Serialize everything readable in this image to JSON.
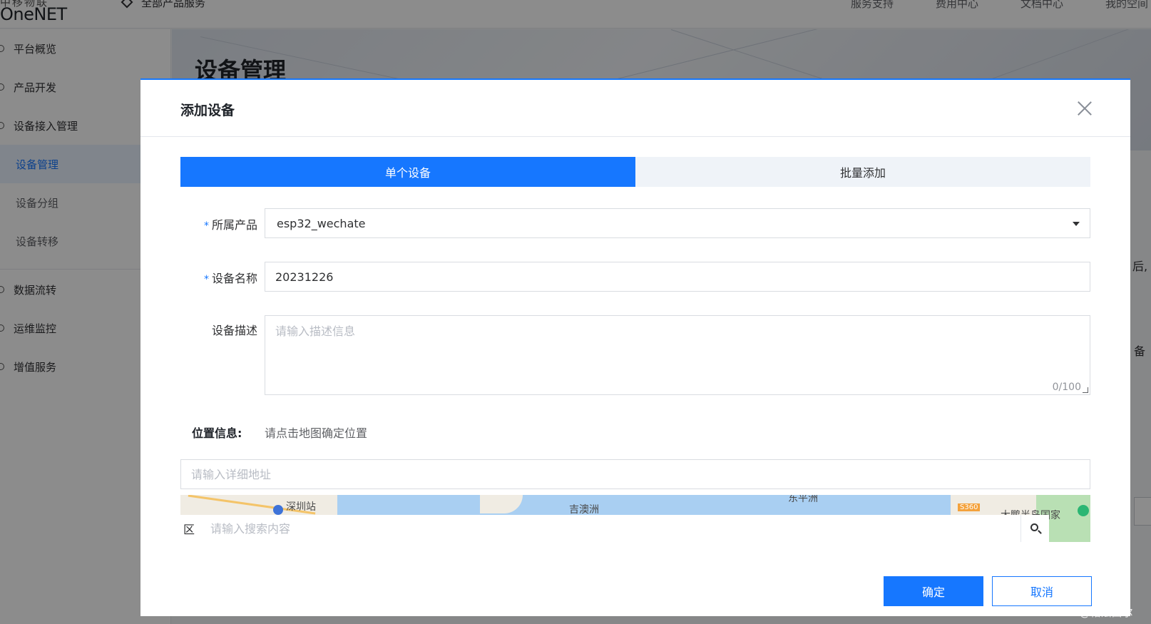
{
  "header": {
    "logo_top": "中移物联",
    "logo": "OneNET",
    "all_products": "全部产品服务",
    "nav": [
      "服务支持",
      "费用中心",
      "文档中心",
      "我的空间"
    ]
  },
  "sidebar": {
    "items": [
      "平台概览",
      "产品开发",
      "设备接入管理",
      "设备管理",
      "设备分组",
      "设备转移",
      "数据流转",
      "运维监控",
      "增值服务"
    ]
  },
  "page": {
    "title": "设备管理",
    "bg_fragments": [
      "后,",
      "备"
    ]
  },
  "modal": {
    "title": "添加设备",
    "tabs": [
      {
        "label": "单个设备",
        "active": true
      },
      {
        "label": "批量添加",
        "active": false
      }
    ],
    "product_label": "所属产品",
    "product_value": "esp32_wechate",
    "device_name_label": "设备名称",
    "device_name_value": "20231226",
    "description_label": "设备描述",
    "description_placeholder": "请输入描述信息",
    "description_counter": "0/100",
    "required_mark": "*",
    "location_label": "位置信息:",
    "location_hint": "请点击地图确定位置",
    "address_placeholder": "请输入详细地址",
    "map": {
      "labels": [
        "深圳站",
        "吉澳洲",
        "东平洲",
        "大鹏半岛国家"
      ],
      "road_marker": "S360",
      "search_prefix": "区",
      "search_placeholder": "请输入搜索内容"
    },
    "confirm_label": "确定",
    "cancel_label": "取消"
  },
  "watermark": "CSDN @帕法西尔",
  "colors": {
    "primary": "#1677ff",
    "overlay": "rgba(0,0,0,0.45)",
    "tab_inactive": "#eff3f8"
  }
}
